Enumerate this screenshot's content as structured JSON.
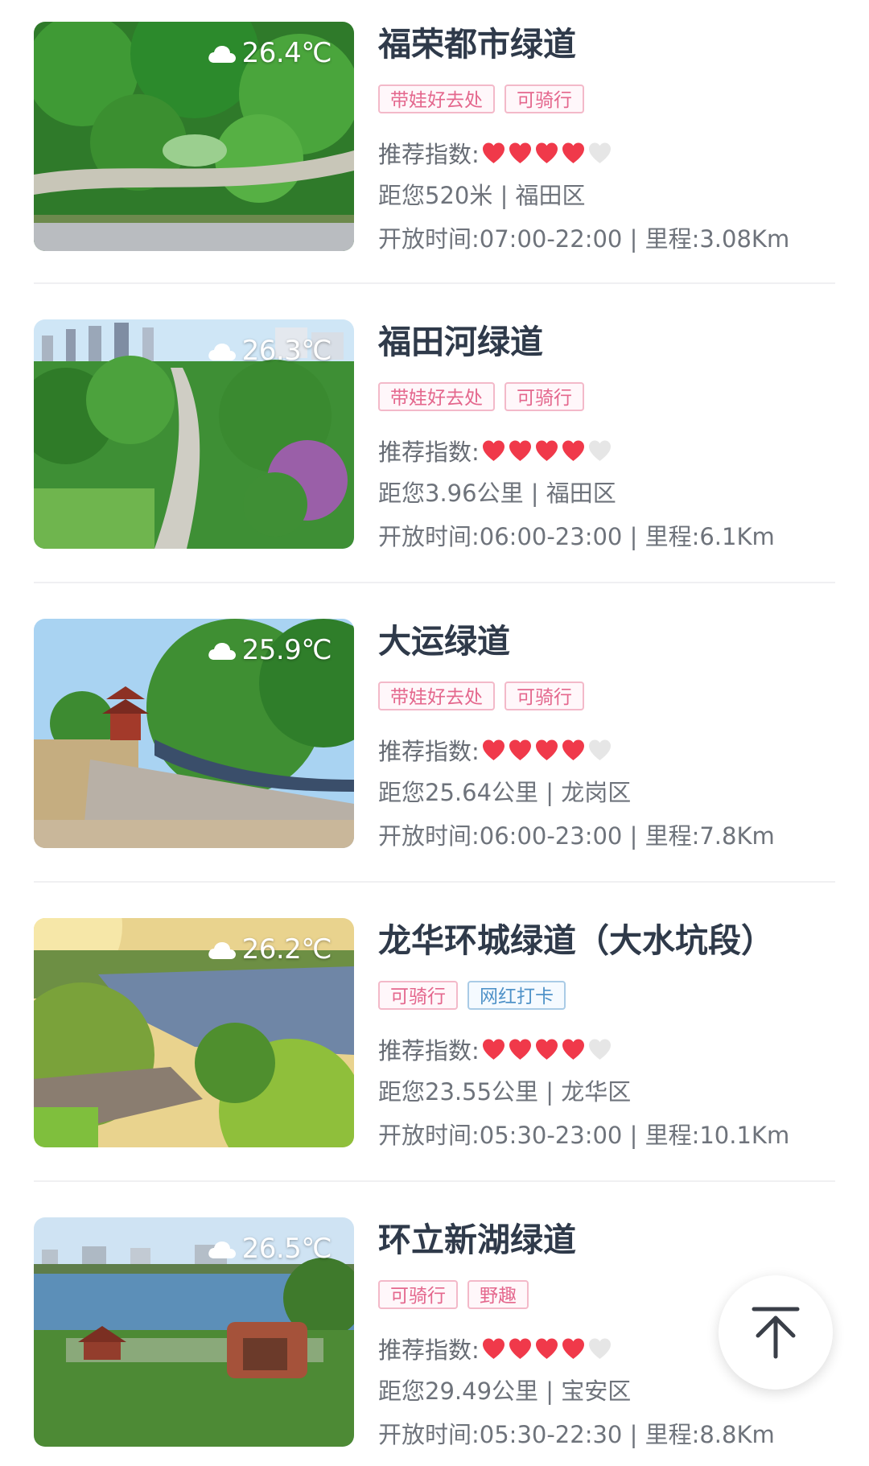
{
  "colors": {
    "title": "#2f3a4a",
    "heart_filled": "#f0394a",
    "heart_empty": "#e6e6e6",
    "tag_pink": "#e4678d",
    "tag_blue": "#4f92c8"
  },
  "rating_label": "推荐指数:",
  "icons": {
    "weather": "cloud-icon",
    "rating": "heart-icon",
    "scroll_top": "arrow-up-to-top-icon"
  },
  "greenways": [
    {
      "name": "福荣都市绿道",
      "temperature": "26.4℃",
      "tags": [
        {
          "label": "带娃好去处",
          "style": "pink"
        },
        {
          "label": "可骑行",
          "style": "pink"
        }
      ],
      "rating": {
        "filled": 4,
        "max": 5
      },
      "distance_line": "距您520米 | 福田区",
      "hours_line": "开放时间:07:00-22:00 | 里程:3.08Km"
    },
    {
      "name": "福田河绿道",
      "temperature": "26.3℃",
      "tags": [
        {
          "label": "带娃好去处",
          "style": "pink"
        },
        {
          "label": "可骑行",
          "style": "pink"
        }
      ],
      "rating": {
        "filled": 4,
        "max": 5
      },
      "distance_line": "距您3.96公里 | 福田区",
      "hours_line": "开放时间:06:00-23:00 | 里程:6.1Km"
    },
    {
      "name": "大运绿道",
      "temperature": "25.9℃",
      "tags": [
        {
          "label": "带娃好去处",
          "style": "pink"
        },
        {
          "label": "可骑行",
          "style": "pink"
        }
      ],
      "rating": {
        "filled": 4,
        "max": 5
      },
      "distance_line": "距您25.64公里 | 龙岗区",
      "hours_line": "开放时间:06:00-23:00 | 里程:7.8Km"
    },
    {
      "name": "龙华环城绿道（大水坑段）",
      "temperature": "26.2℃",
      "tags": [
        {
          "label": "可骑行",
          "style": "pink"
        },
        {
          "label": "网红打卡",
          "style": "blue"
        }
      ],
      "rating": {
        "filled": 4,
        "max": 5
      },
      "distance_line": "距您23.55公里 | 龙华区",
      "hours_line": "开放时间:05:30-23:00 | 里程:10.1Km"
    },
    {
      "name": "环立新湖绿道",
      "temperature": "26.5℃",
      "tags": [
        {
          "label": "可骑行",
          "style": "pink"
        },
        {
          "label": "野趣",
          "style": "pink"
        }
      ],
      "rating": {
        "filled": 4,
        "max": 5
      },
      "distance_line": "距您29.49公里 | 宝安区",
      "hours_line": "开放时间:05:30-22:30 | 里程:8.8Km"
    }
  ]
}
